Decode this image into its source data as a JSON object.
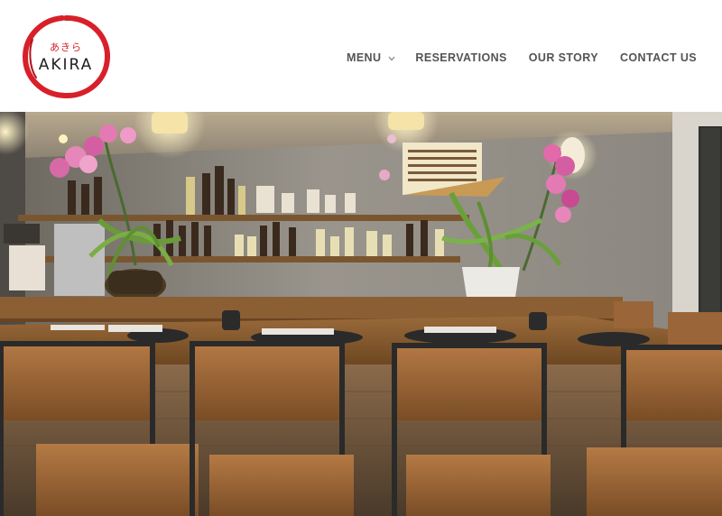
{
  "brand": {
    "kana": "あきら",
    "name": "AKIRA"
  },
  "nav": {
    "items": [
      {
        "label": "MENU",
        "has_dropdown": true
      },
      {
        "label": "RESERVATIONS"
      },
      {
        "label": "OUR STORY"
      },
      {
        "label": "CONTACT US"
      }
    ]
  },
  "colors": {
    "brand_red": "#d8202a",
    "nav_text": "#545454",
    "header_bg": "#ffffff"
  },
  "hero": {
    "description_icon": "restaurant-interior-photo"
  }
}
